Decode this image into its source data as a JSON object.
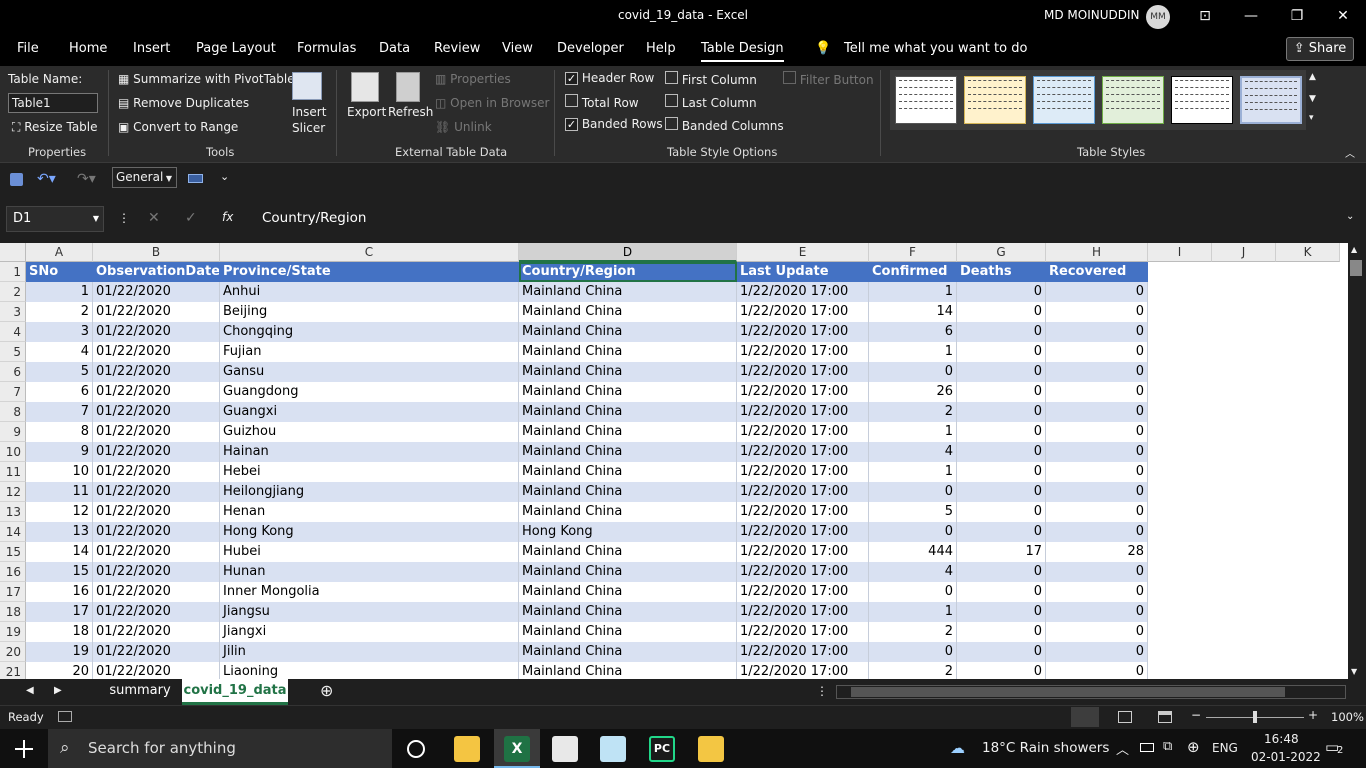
{
  "window": {
    "title": "covid_19_data  -  Excel",
    "user": "MD MOINUDDIN",
    "initials": "MM"
  },
  "menu": [
    "File",
    "Home",
    "Insert",
    "Page Layout",
    "Formulas",
    "Data",
    "Review",
    "View",
    "Developer",
    "Help",
    "Table Design"
  ],
  "tell_me": "Tell me what you want to do",
  "share": "Share",
  "ribbon": {
    "table_name_label": "Table Name:",
    "table_name_value": "Table1",
    "resize": "Resize Table",
    "properties_group": "Properties",
    "summarize": "Summarize with PivotTable",
    "remove_dup": "Remove Duplicates",
    "convert": "Convert to Range",
    "tools_group": "Tools",
    "insert_slicer_1": "Insert",
    "insert_slicer_2": "Slicer",
    "export": "Export",
    "refresh": "Refresh",
    "properties": "Properties",
    "open_browser": "Open in Browser",
    "unlink": "Unlink",
    "external_group": "External Table Data",
    "header_row": "Header Row",
    "total_row": "Total Row",
    "banded_rows": "Banded Rows",
    "first_col": "First Column",
    "last_col": "Last Column",
    "banded_cols": "Banded Columns",
    "filter_btn": "Filter Button",
    "style_options_group": "Table Style Options",
    "styles_group": "Table Styles"
  },
  "qat": {
    "format": "General"
  },
  "formula_bar": {
    "name_box": "D1",
    "fx": "fx",
    "content": "Country/Region"
  },
  "columns": [
    "A",
    "B",
    "C",
    "D",
    "E",
    "F",
    "G",
    "H",
    "I",
    "J",
    "K"
  ],
  "headers": [
    "SNo",
    "ObservationDate",
    "Province/State",
    "Country/Region",
    "Last Update",
    "Confirmed",
    "Deaths",
    "Recovered"
  ],
  "rows": [
    [
      "1",
      "01/22/2020",
      "Anhui",
      "Mainland China",
      "1/22/2020 17:00",
      "1",
      "0",
      "0"
    ],
    [
      "2",
      "01/22/2020",
      "Beijing",
      "Mainland China",
      "1/22/2020 17:00",
      "14",
      "0",
      "0"
    ],
    [
      "3",
      "01/22/2020",
      "Chongqing",
      "Mainland China",
      "1/22/2020 17:00",
      "6",
      "0",
      "0"
    ],
    [
      "4",
      "01/22/2020",
      "Fujian",
      "Mainland China",
      "1/22/2020 17:00",
      "1",
      "0",
      "0"
    ],
    [
      "5",
      "01/22/2020",
      "Gansu",
      "Mainland China",
      "1/22/2020 17:00",
      "0",
      "0",
      "0"
    ],
    [
      "6",
      "01/22/2020",
      "Guangdong",
      "Mainland China",
      "1/22/2020 17:00",
      "26",
      "0",
      "0"
    ],
    [
      "7",
      "01/22/2020",
      "Guangxi",
      "Mainland China",
      "1/22/2020 17:00",
      "2",
      "0",
      "0"
    ],
    [
      "8",
      "01/22/2020",
      "Guizhou",
      "Mainland China",
      "1/22/2020 17:00",
      "1",
      "0",
      "0"
    ],
    [
      "9",
      "01/22/2020",
      "Hainan",
      "Mainland China",
      "1/22/2020 17:00",
      "4",
      "0",
      "0"
    ],
    [
      "10",
      "01/22/2020",
      "Hebei",
      "Mainland China",
      "1/22/2020 17:00",
      "1",
      "0",
      "0"
    ],
    [
      "11",
      "01/22/2020",
      "Heilongjiang",
      "Mainland China",
      "1/22/2020 17:00",
      "0",
      "0",
      "0"
    ],
    [
      "12",
      "01/22/2020",
      "Henan",
      "Mainland China",
      "1/22/2020 17:00",
      "5",
      "0",
      "0"
    ],
    [
      "13",
      "01/22/2020",
      "Hong Kong",
      "Hong Kong",
      "1/22/2020 17:00",
      "0",
      "0",
      "0"
    ],
    [
      "14",
      "01/22/2020",
      "Hubei",
      "Mainland China",
      "1/22/2020 17:00",
      "444",
      "17",
      "28"
    ],
    [
      "15",
      "01/22/2020",
      "Hunan",
      "Mainland China",
      "1/22/2020 17:00",
      "4",
      "0",
      "0"
    ],
    [
      "16",
      "01/22/2020",
      "Inner Mongolia",
      "Mainland China",
      "1/22/2020 17:00",
      "0",
      "0",
      "0"
    ],
    [
      "17",
      "01/22/2020",
      "Jiangsu",
      "Mainland China",
      "1/22/2020 17:00",
      "1",
      "0",
      "0"
    ],
    [
      "18",
      "01/22/2020",
      "Jiangxi",
      "Mainland China",
      "1/22/2020 17:00",
      "2",
      "0",
      "0"
    ],
    [
      "19",
      "01/22/2020",
      "Jilin",
      "Mainland China",
      "1/22/2020 17:00",
      "0",
      "0",
      "0"
    ],
    [
      "20",
      "01/22/2020",
      "Liaoning",
      "Mainland China",
      "1/22/2020 17:00",
      "2",
      "0",
      "0"
    ]
  ],
  "sheets": [
    "summary",
    "covid_19_data"
  ],
  "status": {
    "ready": "Ready",
    "zoom": "100%"
  },
  "taskbar": {
    "search": "Search for anything",
    "weather": "18°C  Rain showers",
    "lang": "ENG",
    "time": "16:48",
    "date": "02-01-2022",
    "notif": "2"
  }
}
